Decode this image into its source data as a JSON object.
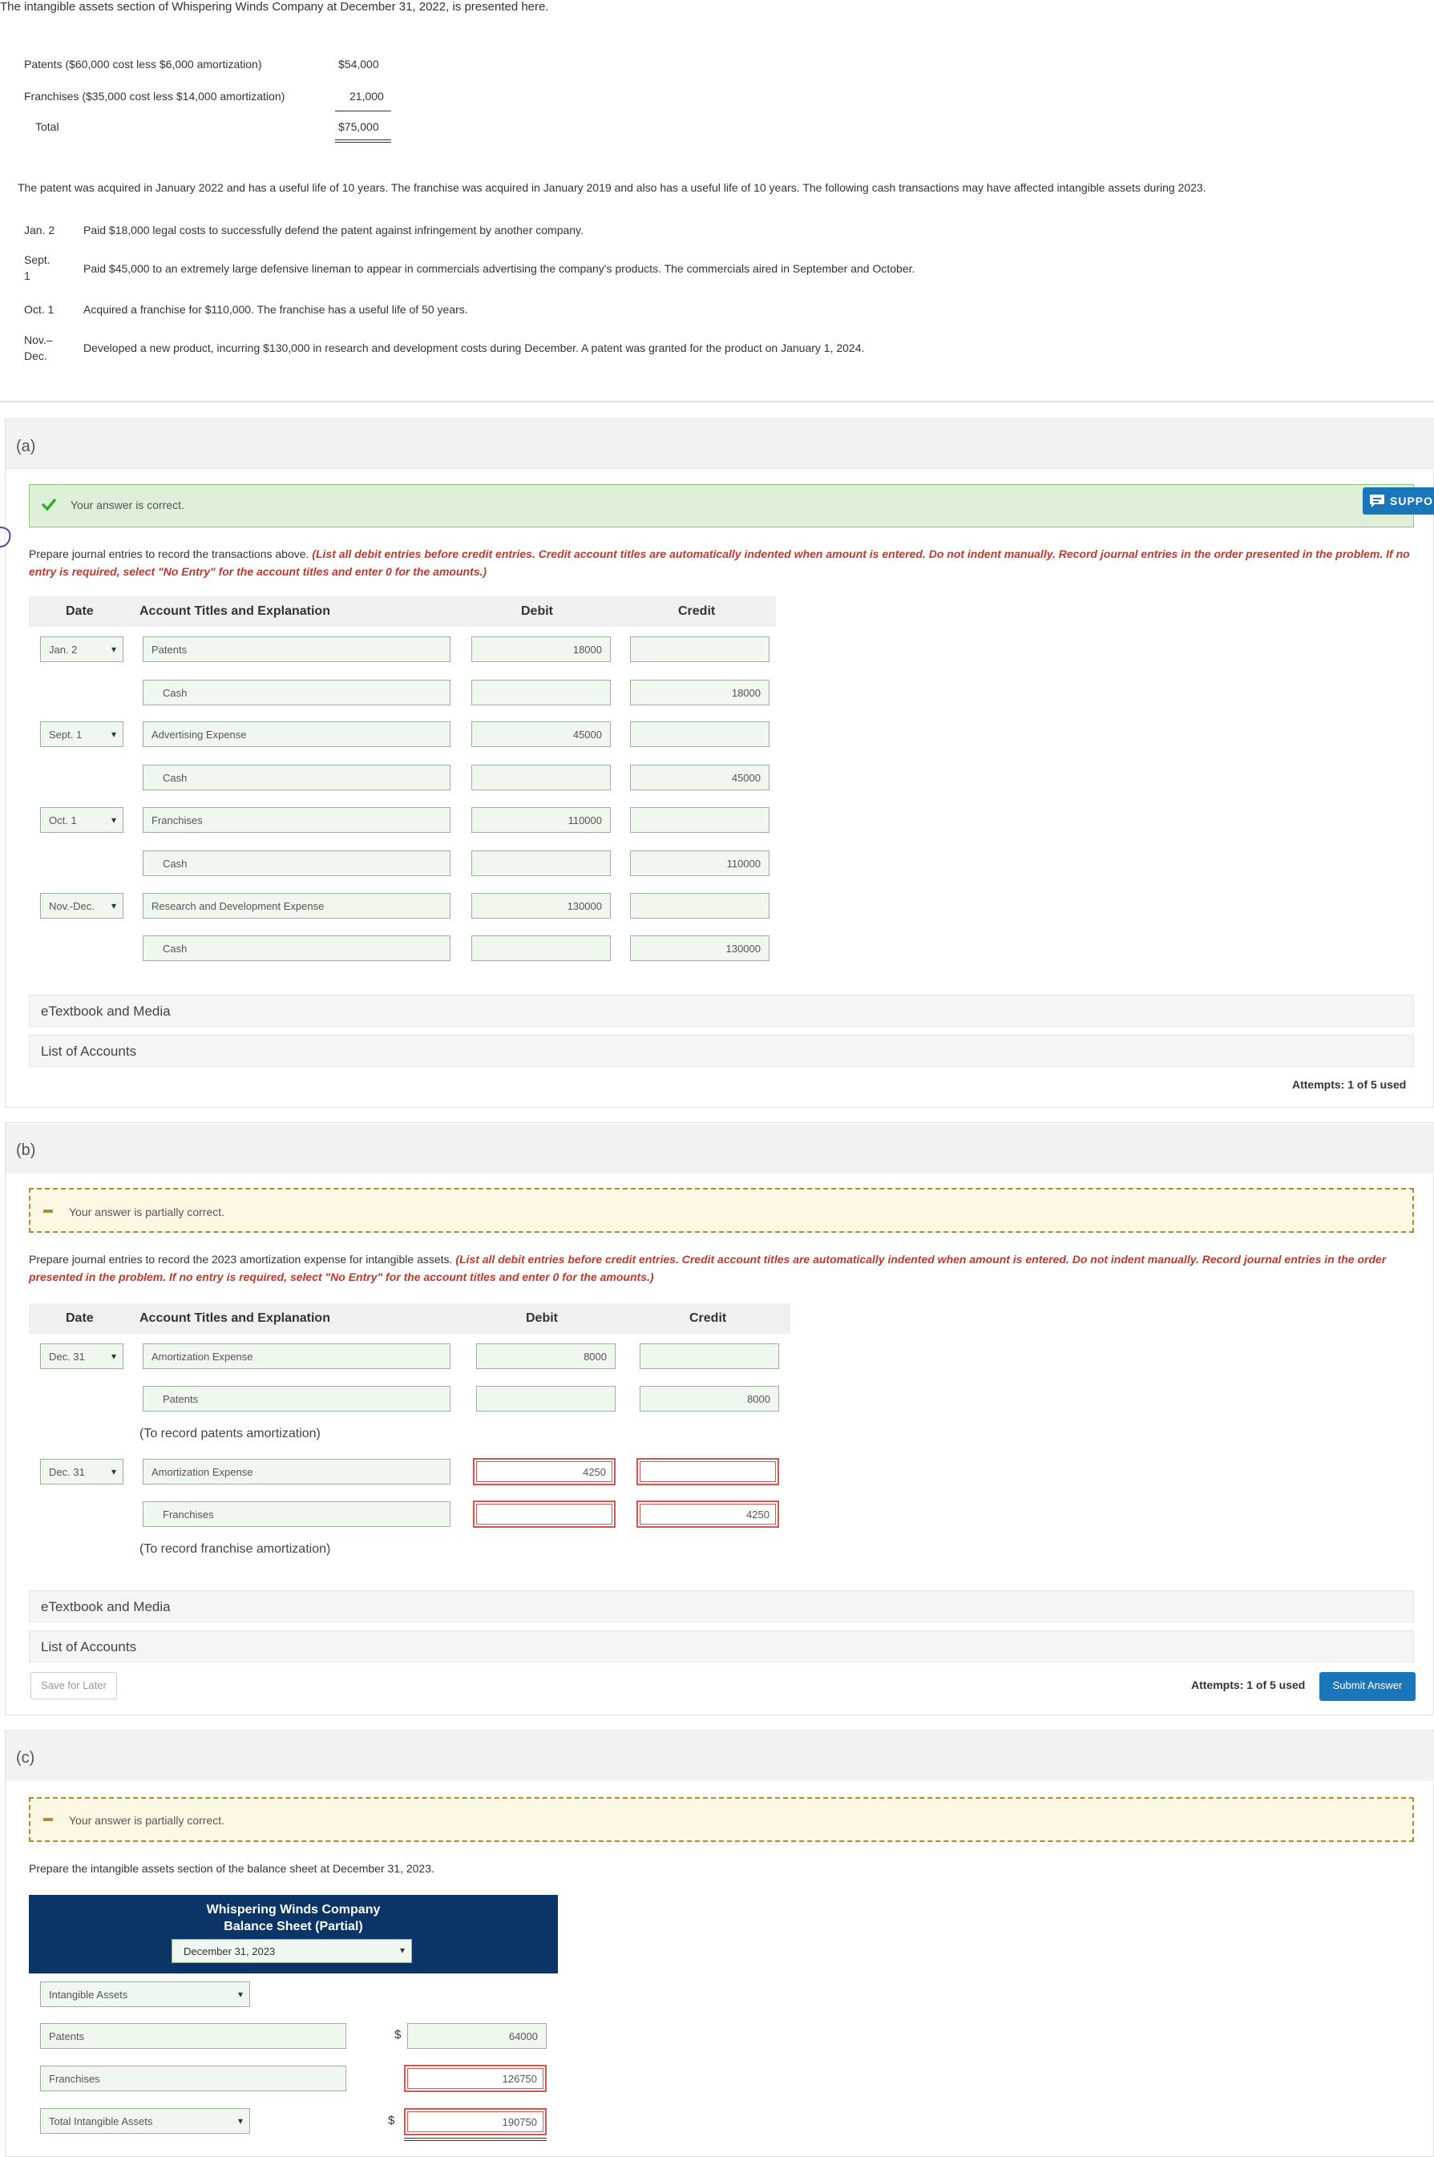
{
  "intro": {
    "text": "The intangible assets section of Whispering Winds Company at December 31, 2022, is presented here.",
    "rows": [
      {
        "label": "Patents ($60,000 cost less $6,000 amortization)",
        "value": "$54,000"
      },
      {
        "label": "Franchises ($35,000 cost less $14,000 amortization)",
        "value": "21,000"
      },
      {
        "label": "Total",
        "value": "$75,000"
      }
    ],
    "paragraph": "The patent was acquired in January 2022 and has a useful life of 10 years. The franchise was acquired in January 2019 and also has a useful life of 10 years. The following cash transactions may have affected intangible assets during 2023.",
    "transactions": [
      {
        "date": "Jan. 2",
        "text": "Paid $18,000 legal costs to successfully defend the patent against infringement by another company."
      },
      {
        "date": "Sept. 1",
        "text": "Paid $45,000 to an extremely large defensive lineman to appear in commercials advertising the company's products. The commercials aired in September and October."
      },
      {
        "date": "Oct. 1",
        "text": "Acquired a franchise for $110,000. The franchise has a useful life of 50 years."
      },
      {
        "date": "Nov.–Dec.",
        "text": "Developed a new product, incurring $130,000 in research and development costs during December. A patent was granted for the product on January 1, 2024."
      }
    ]
  },
  "support_label": "SUPPO",
  "part_a": {
    "label": "(a)",
    "banner": "Your answer is correct.",
    "instruction_plain": "Prepare journal entries to record the transactions above. ",
    "instruction_red": "(List all debit entries before credit entries. Credit account titles are automatically indented when amount is entered. Do not indent manually. Record journal entries in the order presented in the problem. If no entry is required, select \"No Entry\" for the account titles and enter 0 for the amounts.)",
    "headers": {
      "date": "Date",
      "account": "Account Titles and Explanation",
      "debit": "Debit",
      "credit": "Credit"
    },
    "entries": [
      {
        "date": "Jan. 2",
        "debit_account": "Patents",
        "debit": "18000",
        "credit_account": "Cash",
        "credit": "18000"
      },
      {
        "date": "Sept. 1",
        "debit_account": "Advertising Expense",
        "debit": "45000",
        "credit_account": "Cash",
        "credit": "45000"
      },
      {
        "date": "Oct. 1",
        "debit_account": "Franchises",
        "debit": "110000",
        "credit_account": "Cash",
        "credit": "110000"
      },
      {
        "date": "Nov.-Dec.",
        "debit_account": "Research and Development Expense",
        "debit": "130000",
        "credit_account": "Cash",
        "credit": "130000"
      }
    ],
    "etextbook": "eTextbook and Media",
    "list_accounts": "List of Accounts",
    "attempts": "Attempts: 1 of 5 used"
  },
  "part_b": {
    "label": "(b)",
    "banner": "Your answer is partially correct.",
    "instruction_plain": "Prepare journal entries to record the 2023 amortization expense for intangible assets. ",
    "instruction_red": "(List all debit entries before credit entries. Credit account titles are automatically indented when amount is entered. Do not indent manually. Record journal entries in the order presented in the problem. If no entry is required, select \"No Entry\" for the account titles and enter 0 for the amounts.)",
    "headers": {
      "date": "Date",
      "account": "Account Titles and Explanation",
      "debit": "Debit",
      "credit": "Credit"
    },
    "entries": [
      {
        "date": "Dec. 31",
        "debit_account": "Amortization Expense",
        "debit": "8000",
        "credit_account": "Patents",
        "credit": "8000",
        "memo": "(To record patents amortization)"
      },
      {
        "date": "Dec. 31",
        "debit_account": "Amortization Expense",
        "debit": "4250",
        "credit_account": "Franchises",
        "credit": "4250",
        "memo": "(To record franchise amortization)"
      }
    ],
    "etextbook": "eTextbook and Media",
    "list_accounts": "List of Accounts",
    "save_label": "Save for Later",
    "attempts": "Attempts: 1 of 5 used",
    "submit_label": "Submit Answer"
  },
  "part_c": {
    "label": "(c)",
    "banner": "Your answer is partially correct.",
    "instruction": "Prepare the intangible assets section of the balance sheet at December 31, 2023.",
    "company": "Whispering Winds Company",
    "statement": "Balance Sheet (Partial)",
    "date_select": "December 31, 2023",
    "section_select": "Intangible Assets",
    "rows": [
      {
        "label": "Patents",
        "value": "64000"
      },
      {
        "label": "Franchises",
        "value": "126750"
      }
    ],
    "total_label": "Total Intangible Assets",
    "total_value": "190750",
    "currency": "$"
  }
}
